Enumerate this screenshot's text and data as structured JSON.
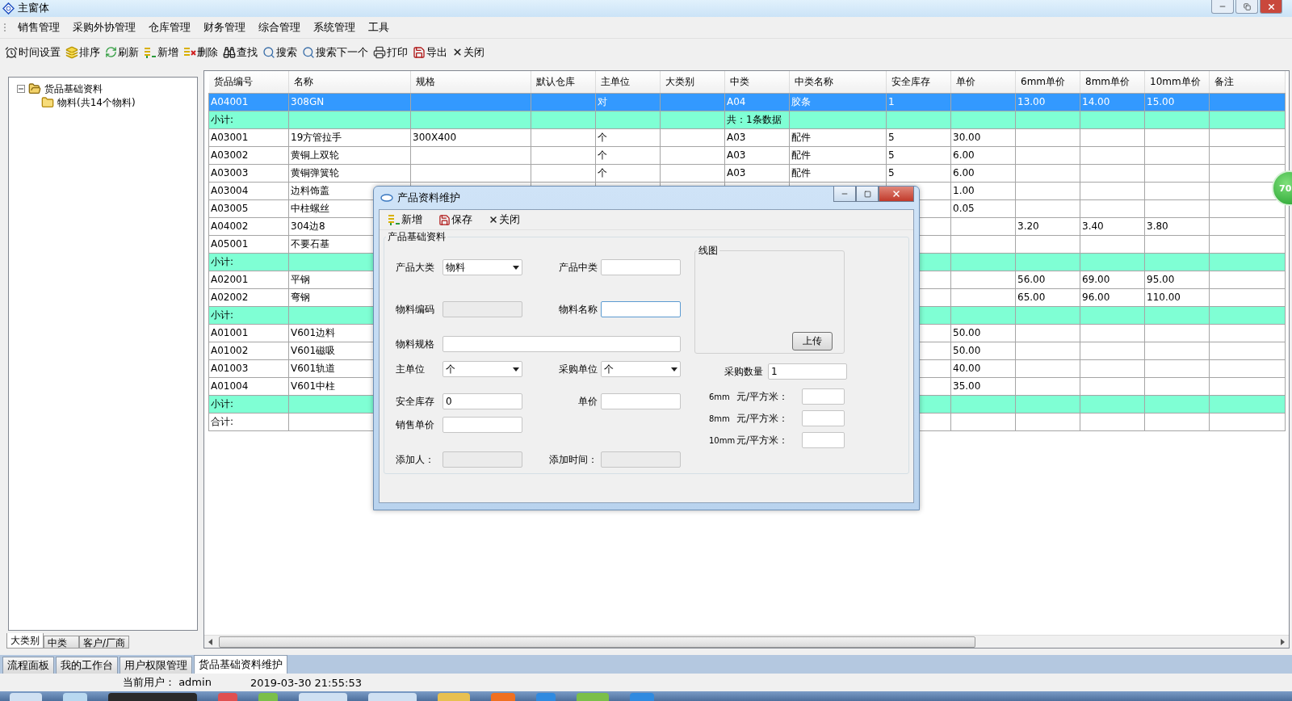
{
  "window": {
    "title": "主窗体"
  },
  "menu": [
    "销售管理",
    "采购外协管理",
    "仓库管理",
    "财务管理",
    "综合管理",
    "系统管理",
    "工具"
  ],
  "toolbar": [
    "时间设置",
    "排序",
    "刷新",
    "新增",
    "删除",
    "查找",
    "搜索",
    "搜索下一个",
    "打印",
    "导出",
    "关闭"
  ],
  "tree": {
    "items": [
      {
        "label": "货品基础资料",
        "expanded": true,
        "children": [
          {
            "label": "物料(共14个物料)"
          }
        ]
      }
    ]
  },
  "left_tabs": [
    {
      "label": "大类别",
      "selected": true
    },
    {
      "label": "中类",
      "selected": false
    },
    {
      "label": "客户/厂商",
      "selected": false
    }
  ],
  "table": {
    "columns": [
      "货品编号",
      "名称",
      "规格",
      "默认仓库",
      "主单位",
      "大类别",
      "中类",
      "中类名称",
      "安全库存",
      "单价",
      "6mm单价",
      "8mm单价",
      "10mm单价",
      "备注"
    ],
    "rows": [
      {
        "kind": "data",
        "selected": true,
        "cells": [
          "A04001",
          "308GN",
          null,
          null,
          "对",
          null,
          "A04",
          "胶条",
          "1",
          null,
          "13.00",
          "14.00",
          "15.00",
          null
        ]
      },
      {
        "kind": "subtotal",
        "selected": false,
        "cells": [
          "小计:",
          null,
          null,
          null,
          null,
          null,
          "共：1条数据",
          null,
          null,
          null,
          null,
          null,
          null,
          null
        ]
      },
      {
        "kind": "data",
        "selected": false,
        "cells": [
          "A03001",
          "19方管拉手",
          "300X400",
          null,
          "个",
          null,
          "A03",
          "配件",
          "5",
          "30.00",
          null,
          null,
          null,
          null
        ]
      },
      {
        "kind": "data",
        "selected": false,
        "cells": [
          "A03002",
          "黄铜上双轮",
          null,
          null,
          "个",
          null,
          "A03",
          "配件",
          "5",
          "6.00",
          null,
          null,
          null,
          null
        ]
      },
      {
        "kind": "data",
        "selected": false,
        "cells": [
          "A03003",
          "黄铜弹簧轮",
          null,
          null,
          "个",
          null,
          "A03",
          "配件",
          "5",
          "6.00",
          null,
          null,
          null,
          null
        ]
      },
      {
        "kind": "data",
        "selected": false,
        "cells": [
          "A03004",
          "边料饰盖",
          null,
          null,
          null,
          null,
          null,
          null,
          null,
          "1.00",
          null,
          null,
          null,
          null
        ]
      },
      {
        "kind": "data",
        "selected": false,
        "cells": [
          "A03005",
          "中柱螺丝",
          null,
          null,
          null,
          null,
          null,
          null,
          null,
          "0.05",
          null,
          null,
          null,
          null
        ]
      },
      {
        "kind": "data",
        "selected": false,
        "cells": [
          "A04002",
          "304边8",
          null,
          null,
          null,
          null,
          null,
          null,
          null,
          null,
          "3.20",
          "3.40",
          "3.80",
          null
        ]
      },
      {
        "kind": "data",
        "selected": false,
        "cells": [
          "A05001",
          "不要石基",
          null,
          null,
          null,
          null,
          null,
          null,
          null,
          null,
          null,
          null,
          null,
          null
        ]
      },
      {
        "kind": "subtotal",
        "selected": false,
        "cells": [
          "小计:",
          null,
          null,
          null,
          null,
          null,
          null,
          null,
          null,
          null,
          null,
          null,
          null,
          null
        ]
      },
      {
        "kind": "data",
        "selected": false,
        "cells": [
          "A02001",
          "平钢",
          null,
          null,
          null,
          null,
          null,
          null,
          null,
          null,
          "56.00",
          "69.00",
          "95.00",
          null
        ]
      },
      {
        "kind": "data",
        "selected": false,
        "cells": [
          "A02002",
          "弯钢",
          null,
          null,
          null,
          null,
          null,
          null,
          null,
          null,
          "65.00",
          "96.00",
          "110.00",
          null
        ]
      },
      {
        "kind": "subtotal",
        "selected": false,
        "cells": [
          "小计:",
          null,
          null,
          null,
          null,
          null,
          null,
          null,
          null,
          null,
          null,
          null,
          null,
          null
        ]
      },
      {
        "kind": "data",
        "selected": false,
        "cells": [
          "A01001",
          "V601边料",
          null,
          null,
          null,
          null,
          null,
          null,
          null,
          "50.00",
          null,
          null,
          null,
          null
        ]
      },
      {
        "kind": "data",
        "selected": false,
        "cells": [
          "A01002",
          "V601磁吸",
          null,
          null,
          null,
          null,
          null,
          null,
          null,
          "50.00",
          null,
          null,
          null,
          null
        ]
      },
      {
        "kind": "data",
        "selected": false,
        "cells": [
          "A01003",
          "V601轨道",
          null,
          null,
          null,
          null,
          null,
          null,
          null,
          "40.00",
          null,
          null,
          null,
          null
        ]
      },
      {
        "kind": "data",
        "selected": false,
        "cells": [
          "A01004",
          "V601中柱",
          null,
          null,
          null,
          null,
          null,
          null,
          null,
          "35.00",
          null,
          null,
          null,
          null
        ]
      },
      {
        "kind": "subtotal",
        "selected": false,
        "cells": [
          "小计:",
          null,
          null,
          null,
          null,
          null,
          null,
          null,
          null,
          null,
          null,
          null,
          null,
          null
        ]
      },
      {
        "kind": "total",
        "selected": false,
        "cells": [
          "合计:",
          null,
          null,
          null,
          null,
          null,
          null,
          null,
          null,
          null,
          null,
          null,
          null,
          null
        ]
      }
    ]
  },
  "dialog": {
    "title": "产品资料维护",
    "toolbar": [
      "新增",
      "保存",
      "关闭"
    ],
    "group_title": "产品基础资料",
    "rows": [
      [
        {
          "label": "产品大类",
          "kind": "combo",
          "value": "物料"
        },
        {
          "label": "产品中类",
          "kind": "text"
        }
      ],
      [
        {
          "label": "物料编码",
          "kind": "text",
          "disabled": true
        },
        {
          "label": "物料名称",
          "kind": "text",
          "focused": true
        }
      ],
      [
        {
          "label": "物料规格",
          "kind": "wide"
        }
      ],
      [
        {
          "label": "主单位",
          "kind": "combo",
          "value": "个"
        },
        {
          "label": "采购单位",
          "kind": "combo",
          "value": "个"
        }
      ],
      [
        {
          "label": "安全库存",
          "kind": "text",
          "value": "0"
        },
        {
          "label": "单价",
          "kind": "text"
        }
      ],
      [
        {
          "label": "销售单价",
          "kind": "text"
        }
      ],
      [
        {
          "label": "添加人：",
          "kind": "text",
          "disabled": true
        },
        {
          "label": "添加时间：",
          "kind": "text",
          "disabled": true
        }
      ]
    ],
    "image_group": {
      "title": "线图",
      "button": "上传"
    },
    "quantity": {
      "label": "采购数量",
      "value": "1"
    },
    "prices": [
      {
        "size": "6mm",
        "label": "元/平方米："
      },
      {
        "size": "8mm",
        "label": "元/平方米："
      },
      {
        "size": "10mm",
        "label": "元/平方米："
      }
    ]
  },
  "document_tabs": [
    {
      "label": "流程面板",
      "selected": false
    },
    {
      "label": "我的工作台",
      "selected": false
    },
    {
      "label": "用户权限管理",
      "selected": false
    },
    {
      "label": "货品基础资料维护",
      "selected": true
    }
  ],
  "status_bar": {
    "user": "当前用户： admin",
    "time": "2019-03-30 21:55:53"
  },
  "floating_badge": "70"
}
